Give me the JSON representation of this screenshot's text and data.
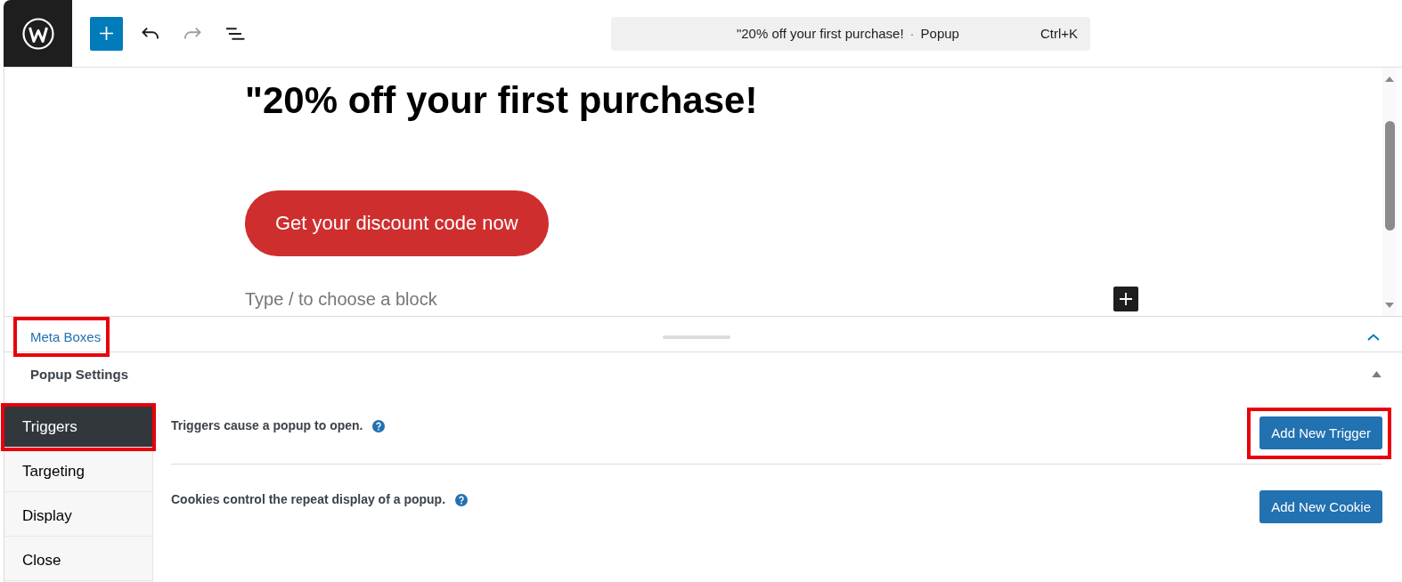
{
  "top_bar": {
    "toolbar": {
      "undo": {
        "disabled": false
      },
      "redo": {
        "disabled": true
      }
    },
    "command_bar": {
      "title": "\"20% off your first purchase!",
      "separator": "·",
      "post_type": "Popup",
      "shortcut": "Ctrl+K"
    }
  },
  "canvas": {
    "heading": "\"20% off your first purchase!",
    "button": "Get your discount code now",
    "empty_block": {
      "placeholder": "Type / to choose a block"
    }
  },
  "meta_boxes": {
    "label": "Meta Boxes",
    "highlighted": true,
    "expanded": true,
    "panel": {
      "title": "Popup Settings",
      "expanded": true,
      "tabs": [
        {
          "label": "Triggers",
          "selected": true,
          "highlighted": true
        },
        {
          "label": "Targeting",
          "selected": false,
          "highlighted": false
        },
        {
          "label": "Display",
          "selected": false,
          "highlighted": false
        },
        {
          "label": "Close",
          "selected": false,
          "highlighted": false
        }
      ],
      "rows": [
        {
          "text": "Triggers cause a popup to open.",
          "button": {
            "label": "Add New Trigger",
            "highlighted": true
          }
        },
        {
          "text": "Cookies control the repeat display of a popup.",
          "button": {
            "label": "Add New Cookie",
            "highlighted": false
          }
        }
      ]
    }
  }
}
